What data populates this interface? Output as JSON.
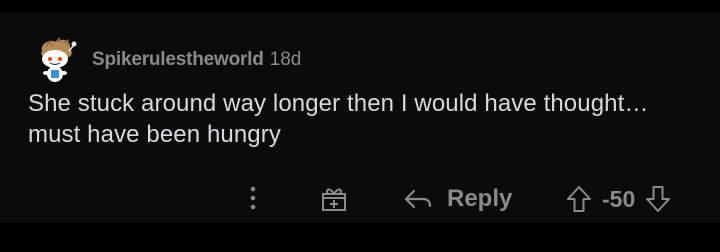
{
  "comment": {
    "username": "Spikerulestheworld",
    "age": "18d",
    "body": "She stuck around way longer then I would have thought… must have been hungry"
  },
  "actions": {
    "more_icon": "more-vertical-icon",
    "award_icon": "gift-award-icon",
    "reply_icon": "reply-arrow-icon",
    "reply_label": "Reply",
    "upvote_icon": "upvote-arrow-icon",
    "score": "-50",
    "downvote_icon": "downvote-arrow-icon"
  },
  "colors": {
    "background": "#000000",
    "card": "#0b0b0b",
    "body_text": "#d7dadc",
    "muted": "#8a8a8a"
  }
}
